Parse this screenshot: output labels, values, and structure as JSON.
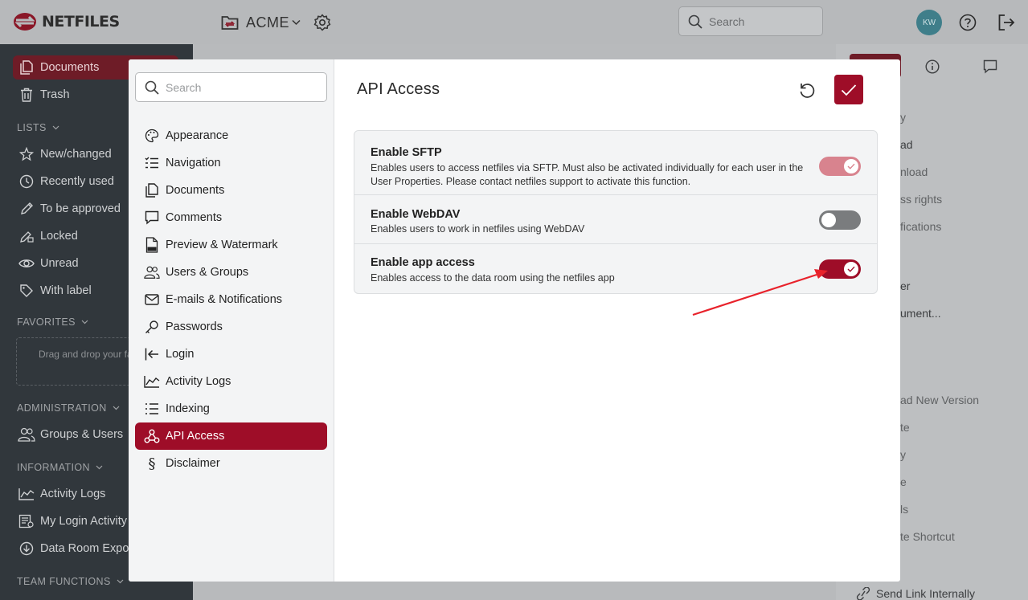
{
  "app": {
    "logo_text": "NETFILES",
    "workspace_name": "ACME",
    "search_placeholder": "Search",
    "user_initials": "KW"
  },
  "leftnav": {
    "items_top": [
      {
        "label": "Documents",
        "icon": "documents-icon",
        "active": true
      },
      {
        "label": "Trash",
        "icon": "trash-icon"
      }
    ],
    "lists_label": "LISTS",
    "lists": [
      {
        "label": "New/changed",
        "icon": "star-icon"
      },
      {
        "label": "Recently used",
        "icon": "clock-icon"
      },
      {
        "label": "To be approved",
        "icon": "pencil-icon"
      },
      {
        "label": "Locked",
        "icon": "lock-edit-icon"
      },
      {
        "label": "Unread",
        "icon": "eye-icon"
      },
      {
        "label": "With label",
        "icon": "tag-icon"
      }
    ],
    "favorites_label": "FAVORITES",
    "favorites_drop_text": "Drag and drop your fa here",
    "administration_label": "ADMINISTRATION",
    "administration": [
      {
        "label": "Groups & Users",
        "icon": "users-icon"
      }
    ],
    "information_label": "INFORMATION",
    "information": [
      {
        "label": "Activity Logs",
        "icon": "activity-icon"
      },
      {
        "label": "My Login Activity",
        "icon": "login-activity-icon"
      },
      {
        "label": "Data Room Expor",
        "icon": "download-icon"
      }
    ],
    "team_functions_label": "TEAM FUNCTIONS"
  },
  "rightpanel": {
    "items": [
      "ad",
      "nload",
      "ss rights",
      "fications",
      "er",
      "ument...",
      "ad New Version",
      "te",
      "y",
      "e",
      "ls",
      "te Shortcut"
    ],
    "send_link": "Send Link Internally"
  },
  "modal": {
    "search_placeholder": "Search",
    "title": "API Access",
    "menu": [
      {
        "label": "Appearance",
        "icon": "palette-icon"
      },
      {
        "label": "Navigation",
        "icon": "navigation-list-icon"
      },
      {
        "label": "Documents",
        "icon": "documents-icon"
      },
      {
        "label": "Comments",
        "icon": "comment-icon"
      },
      {
        "label": "Preview & Watermark",
        "icon": "pdf-icon"
      },
      {
        "label": "Users & Groups",
        "icon": "users-icon"
      },
      {
        "label": "E-mails & Notifications",
        "icon": "mail-icon"
      },
      {
        "label": "Passwords",
        "icon": "key-icon"
      },
      {
        "label": "Login",
        "icon": "login-icon"
      },
      {
        "label": "Activity Logs",
        "icon": "activity-icon"
      },
      {
        "label": "Indexing",
        "icon": "list-icon"
      },
      {
        "label": "API Access",
        "icon": "webhook-icon",
        "active": true
      },
      {
        "label": "Disclaimer",
        "icon": "paragraph-icon"
      }
    ],
    "settings": [
      {
        "title": "Enable SFTP",
        "description": "Enables users to access netfiles via SFTP. Must also be activated individually for each user in the User Properties. Please contact netfiles support to activate this function.",
        "enabled": true,
        "disabled_control": true
      },
      {
        "title": "Enable WebDAV",
        "description": "Enables users to work in netfiles using WebDAV",
        "enabled": false
      },
      {
        "title": "Enable app access",
        "description": "Enables access to the data room using the netfiles app",
        "enabled": true
      }
    ]
  },
  "colors": {
    "brand": "#9e0d28",
    "brand_light": "#d8838e",
    "toggle_off": "#7a7c7e",
    "annotation_arrow": "#e8222b"
  }
}
